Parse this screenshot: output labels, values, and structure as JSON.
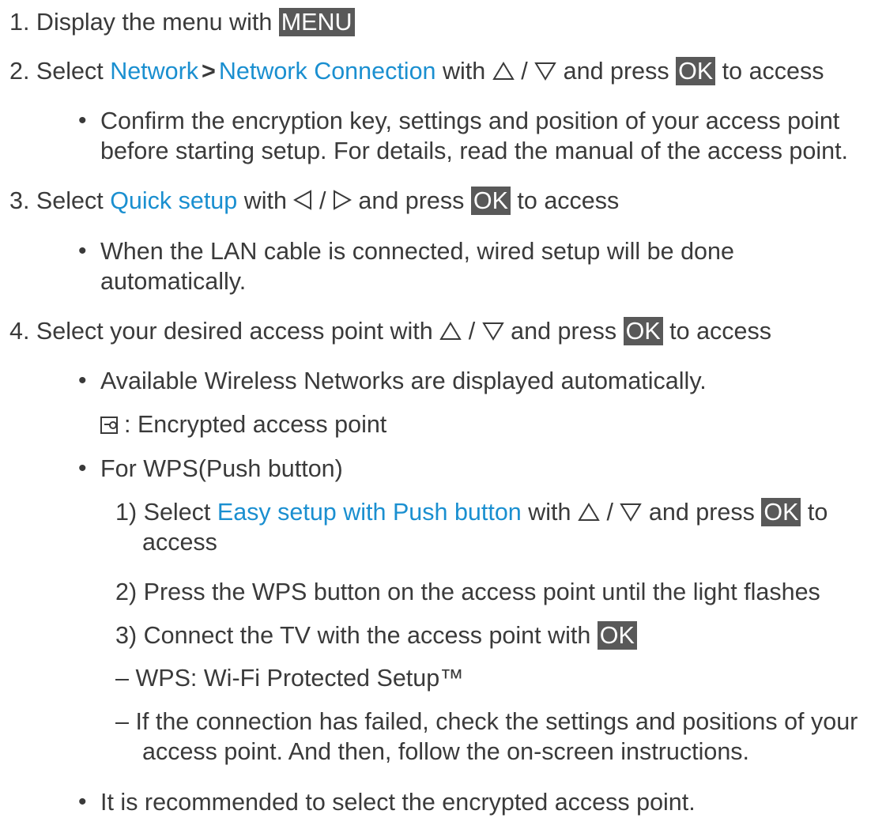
{
  "steps": {
    "s1": {
      "num": "1.",
      "text": "Display the menu with",
      "key": "MENU"
    },
    "s2": {
      "num": "2.",
      "pre": "Select",
      "link1": "Network",
      "sep": ">",
      "link2": "Network Connection",
      "mid": "with",
      "slash": "/",
      "post1": "and press",
      "key": "OK",
      "post2": "to access"
    },
    "s2_note": {
      "line1": "Confirm the encryption key, settings and position of your access point",
      "line2": "before starting setup. For details, read the manual of the access point."
    },
    "s3": {
      "num": "3.",
      "pre": "Select",
      "link": "Quick setup",
      "mid": "with",
      "slash": "/",
      "post1": "and press",
      "key": "OK",
      "post2": "to access"
    },
    "s3_note": {
      "line1": "When the LAN cable is connected, wired setup will be done",
      "line2": "automatically."
    },
    "s4": {
      "num": "4.",
      "pre": "Select your desired access point with",
      "slash": "/",
      "post1": "and press",
      "key": "OK",
      "post2": "to access"
    },
    "s4_note1": "Available Wireless Networks are displayed automatically.",
    "s4_icon_text": ": Encrypted access point",
    "s4_note2": "For WPS(Push button)",
    "sub1": {
      "num": "1)",
      "pre": "Select",
      "link": "Easy setup with Push button",
      "mid": "with",
      "slash": "/",
      "post1": "and press",
      "key": "OK",
      "post2": "to",
      "line2": "access"
    },
    "sub2": {
      "num": "2)",
      "text": "Press the WPS button on the access point until the light flashes"
    },
    "sub3": {
      "num": "3)",
      "text": "Connect the TV with the access point with",
      "key": "OK"
    },
    "dash1": {
      "dash": "–",
      "text": "WPS: Wi-Fi Protected Setup™"
    },
    "dash2": {
      "dash": "–",
      "line1": "If the connection has failed, check the settings and positions of your",
      "line2": "access point. And then, follow the on-screen instructions."
    },
    "s4_note3": "It is recommended to select the encrypted access point.",
    "bullet": "•"
  }
}
